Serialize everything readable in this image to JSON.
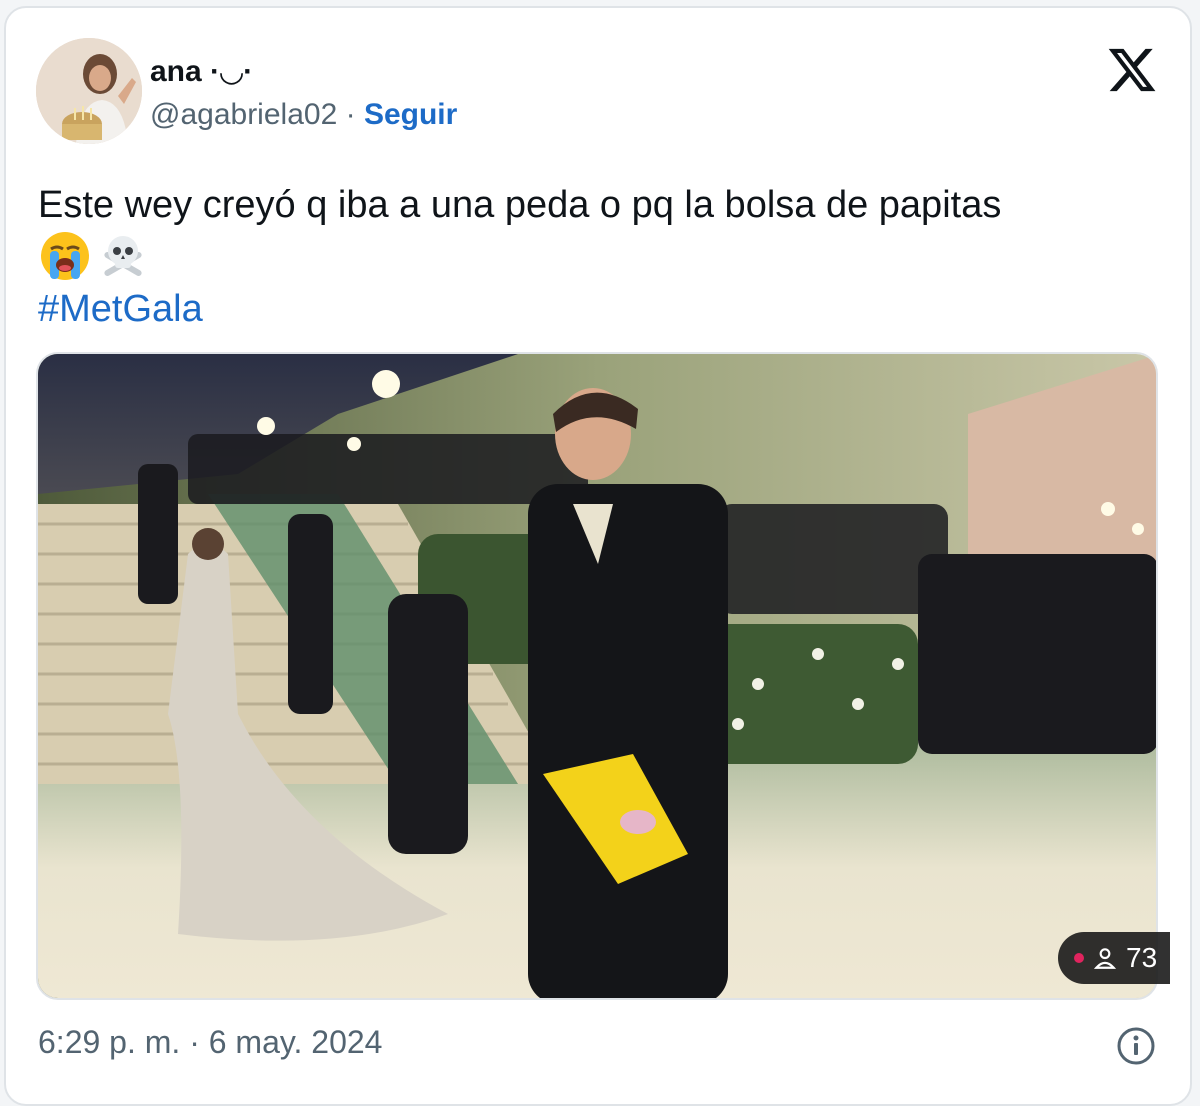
{
  "author": {
    "name": "ana ·◡·",
    "handle": "@agabriela02",
    "separator": " · ",
    "follow_label": "Seguir",
    "avatar_icon": "avatar-photo-icon"
  },
  "platform_icon": "x-logo-icon",
  "tweet": {
    "text": "Este wey creyó q iba a una peda o pq la bolsa de papitas",
    "emojis": [
      "😭",
      "☠️"
    ],
    "hashtag": "#MetGala"
  },
  "media": {
    "type": "video",
    "live_viewers": "73"
  },
  "footer": {
    "timestamp": "6:29 p. m. · 6 may. 2024",
    "info_icon": "info-icon"
  },
  "colors": {
    "link": "#1d6bc7",
    "secondary_text": "#536471",
    "border": "#dfe3e7",
    "live": "#e0245e"
  }
}
